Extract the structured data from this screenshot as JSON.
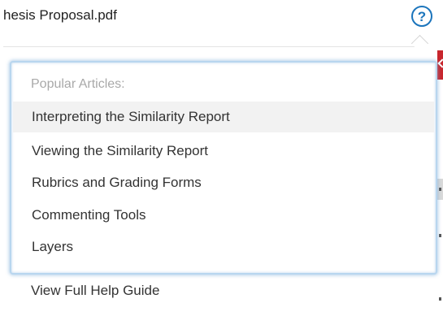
{
  "header": {
    "filename": "hesis Proposal.pdf",
    "help_icon": "question-mark-circle-icon"
  },
  "help_menu": {
    "heading": "Popular Articles:",
    "articles": [
      {
        "label": "Interpreting the Similarity Report",
        "active": true
      },
      {
        "label": "Viewing the Similarity Report"
      },
      {
        "label": "Rubrics and Grading Forms"
      },
      {
        "label": "Commenting Tools"
      },
      {
        "label": "Layers"
      }
    ],
    "full_guide_label": "View Full Help Guide"
  },
  "colors": {
    "accent": "#1c75bc",
    "panel_border": "#b8d6ef",
    "alert_red": "#c8262d"
  }
}
